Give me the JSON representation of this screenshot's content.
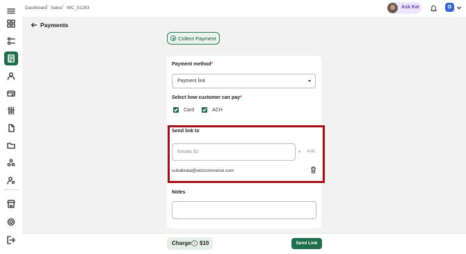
{
  "breadcrumb": {
    "items": [
      "Dashboard",
      "Sales",
      "WC_01283"
    ],
    "separator": "/"
  },
  "header": {
    "ask_kai_label": "Ask Kai",
    "user_initial": "D"
  },
  "page": {
    "title": "Payments",
    "collect_payment_label": "Collect Payment"
  },
  "form": {
    "payment_method": {
      "label": "Payment method",
      "required_mark": "*",
      "value": "Payment link"
    },
    "pay_options": {
      "label": "Select how customer can pay",
      "required_mark": "*",
      "options": [
        {
          "label": "Card",
          "checked": true
        },
        {
          "label": "ACH",
          "checked": true
        }
      ]
    },
    "send_link": {
      "label": "Send link to",
      "email_placeholder": "Emails ID",
      "add_label": "Add",
      "emails": [
        "subabrata@wizcommerce.com"
      ]
    },
    "notes": {
      "label": "Notes",
      "value": ""
    }
  },
  "footer": {
    "charge_label": "Charge",
    "info_symbol": "i",
    "charge_amount": "$10",
    "send_button": "Send Link"
  },
  "colors": {
    "primary": "#1f6f4a",
    "highlight_border": "#a50f12",
    "ask_kai_bg": "#eee6fa",
    "avatar_bg": "#3568d4"
  }
}
